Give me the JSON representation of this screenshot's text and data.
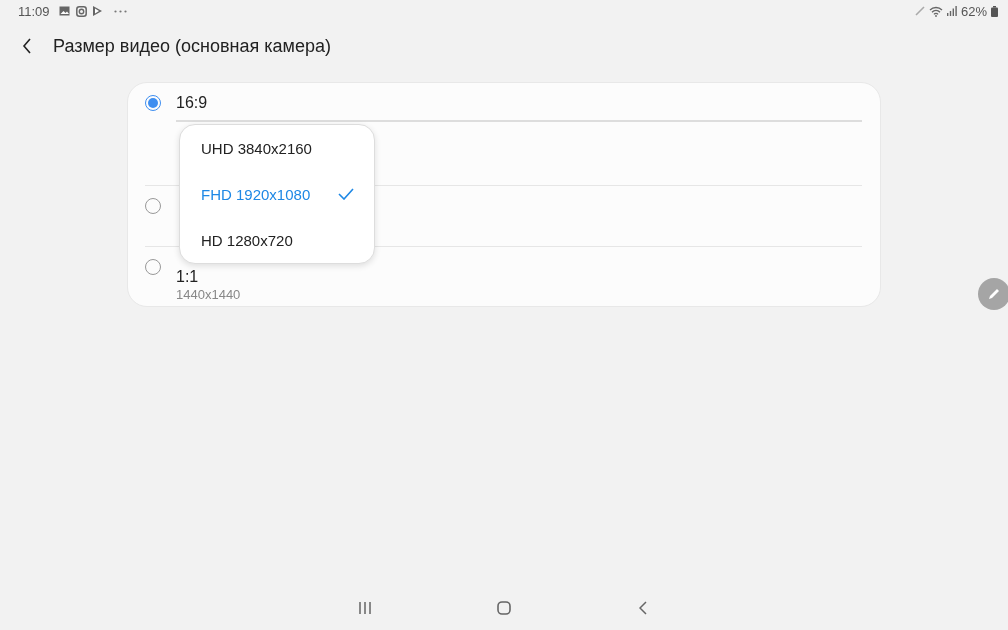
{
  "status_bar": {
    "time": "11:09",
    "battery": "62%"
  },
  "header": {
    "title": "Размер видео (основная камера)"
  },
  "options": [
    {
      "label": "16:9",
      "selected": true
    },
    {
      "selected": false
    },
    {
      "label": "1:1",
      "detail": "1440x1440",
      "selected": false
    }
  ],
  "dropdown": {
    "items": [
      {
        "label": "UHD 3840x2160",
        "selected": false
      },
      {
        "label": "FHD 1920x1080",
        "selected": true
      },
      {
        "label": "HD 1280x720",
        "selected": false
      }
    ]
  }
}
